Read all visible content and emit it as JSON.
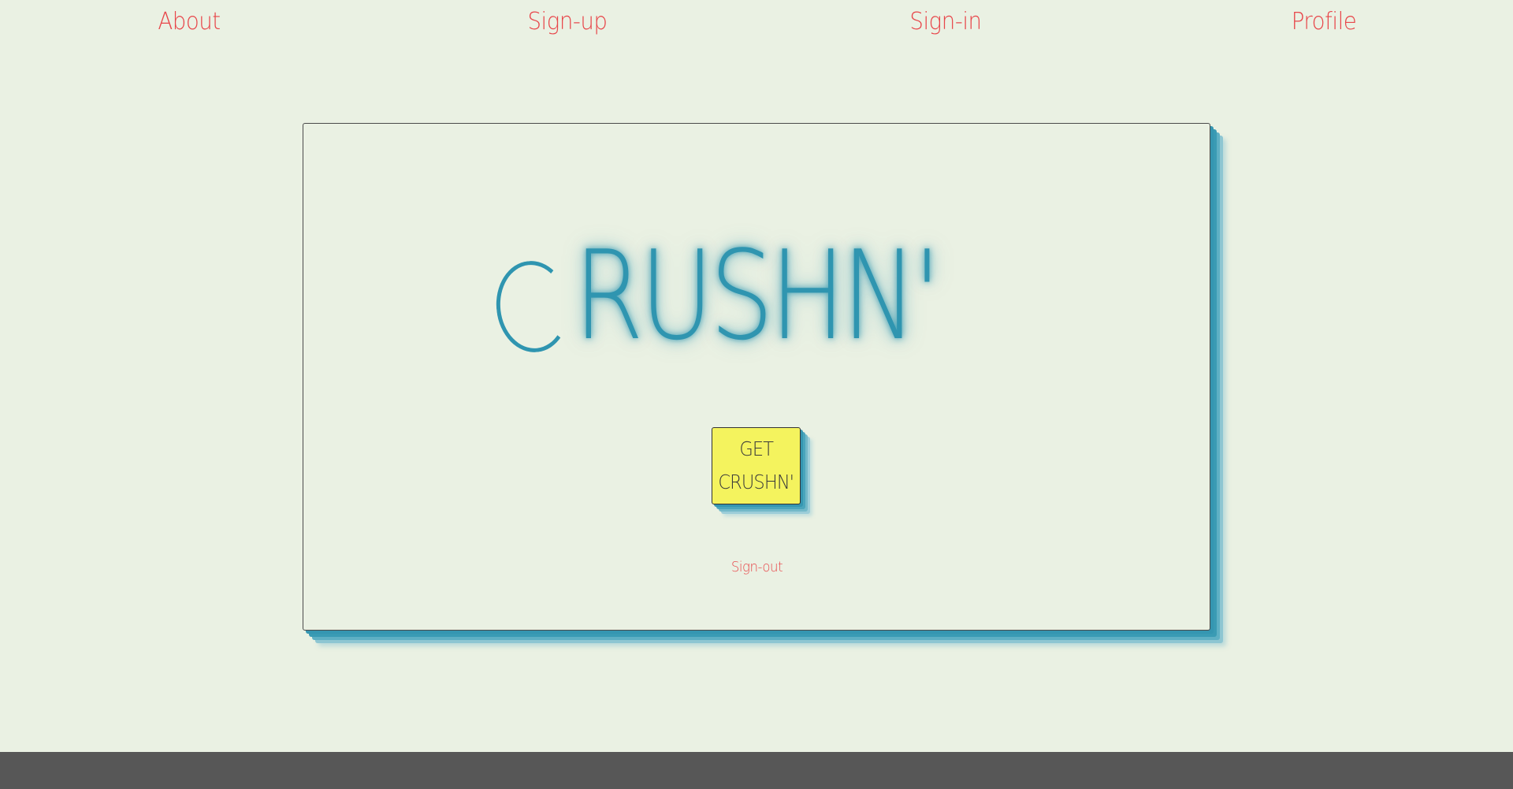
{
  "nav": {
    "items": [
      {
        "label": "About"
      },
      {
        "label": "Sign-up"
      },
      {
        "label": "Sign-in"
      },
      {
        "label": "Profile"
      }
    ]
  },
  "hero": {
    "logo_first": "C",
    "logo_rest": "RUSHN'",
    "cta_line1": "GET",
    "cta_line2": "CRUSHN'",
    "signout_label": "Sign-out"
  },
  "colors": {
    "background": "#eaf1e3",
    "accent": "#2f95b0",
    "link": "#e8464a",
    "button": "#f4f35e",
    "footer": "#575757"
  }
}
